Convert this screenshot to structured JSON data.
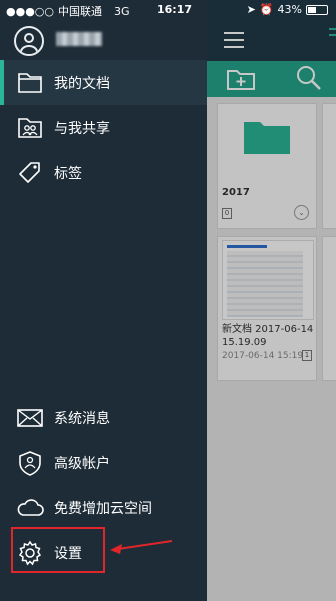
{
  "status_bar": {
    "carrier": "中国联通",
    "network": "3G",
    "time": "16:17",
    "battery_text": "43%",
    "battery_level": 0.43
  },
  "sidebar": {
    "username": "",
    "items": [
      {
        "label": "我的文档",
        "icon": "folder-icon",
        "active": true
      },
      {
        "label": "与我共享",
        "icon": "shared-folder-icon",
        "active": false
      },
      {
        "label": "标签",
        "icon": "tag-icon",
        "active": false
      },
      {
        "label": "系统消息",
        "icon": "mail-icon",
        "active": false
      },
      {
        "label": "高级帐户",
        "icon": "shield-icon",
        "active": false
      },
      {
        "label": "免费增加云空间",
        "icon": "cloud-icon",
        "active": false
      },
      {
        "label": "设置",
        "icon": "gear-icon",
        "active": false
      }
    ]
  },
  "background_app": {
    "folder_name": "2017",
    "doc_name": "新文档 2017-06-14 15.19.09",
    "doc_date": "2017-06-14 15:19",
    "doc_count": "1",
    "folder_count": "0"
  },
  "colors": {
    "drawer_bg": "#1e2c37",
    "active_bg": "#263744",
    "accent": "#2bb597",
    "highlight": "#e0262a"
  }
}
